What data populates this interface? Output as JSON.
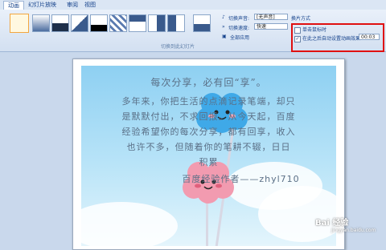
{
  "tabs": [
    "动画",
    "幻灯片放映",
    "审阅",
    "视图"
  ],
  "ribbon": {
    "group_label": "切换到此幻灯片",
    "sound_label": "切换声音:",
    "sound_value": "[无声音]",
    "speed_label": "切换速度:",
    "speed_value": "快速",
    "apply_all_label": "全部应用",
    "advance_title": "换片方式",
    "on_click_label": "单击鼠标时",
    "after_label": "在此之后自动设置动画效果:",
    "after_value": "00:03"
  },
  "slide": {
    "lines": [
      "每次分享，必有回“享”。",
      "多年来，你把生活的点滴记录笔端，却只",
      "是默默付出，不求回报。从今天起，百度",
      "经验希望你的每次分享，都有回享，收入",
      "也许不多，但随着你的笔耕不辍，日日",
      "积累",
      "百度经验作者——zhyl710"
    ]
  },
  "watermark": {
    "logo": "Bai 经验",
    "sub": "jingyan.baidu.com"
  }
}
